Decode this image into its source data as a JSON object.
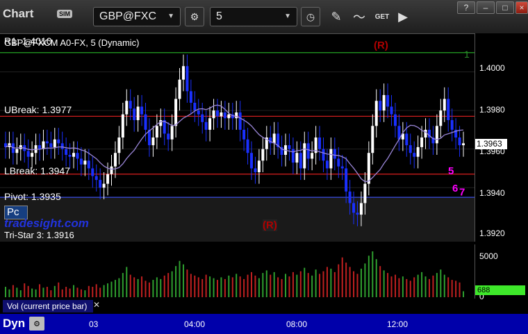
{
  "window": {
    "app_title": "Chart",
    "sim_badge": "SIM",
    "symbol": "GBP@FXC",
    "interval": "5",
    "tool_icons": [
      "settings-gear-icon",
      "clock-icon",
      "pencil-icon",
      "indicator-icon",
      "get-icon"
    ]
  },
  "chart": {
    "header": "GBP@FXCM A0-FX, 5 (Dynamic)",
    "r1_label": "R1: 1.4010",
    "right_marker": "1",
    "r_marker_top": "(R)",
    "r_marker_mid": "(R)",
    "pc_label": "Pc",
    "brand": "tradesight.com",
    "tri_star": "Tri-Star 3: 1.3916",
    "levels": [
      {
        "key": "ubreak",
        "label": "UBreak: 1.3977",
        "value": 1.3977,
        "color": "#e02020"
      },
      {
        "key": "lbreak",
        "label": "LBreak: 1.3947",
        "value": 1.3947,
        "color": "#e02020"
      },
      {
        "key": "pivot",
        "label": "Pivot: 1.3935",
        "value": 1.3935,
        "color": "#3a4de8"
      }
    ],
    "r1_value": 1.401,
    "price_ticks": [
      "1.4000",
      "1.3980",
      "1.3960",
      "1.3940",
      "1.3920"
    ],
    "last_price": "1.3963",
    "volume_ticks": [
      "5000",
      "0"
    ],
    "last_volume": "688",
    "volume_label": "Vol (current price bar)",
    "time_labels": [
      "03",
      "04:00",
      "08:00",
      "12:00"
    ],
    "dyn_label": "Dyn",
    "seq_marks": [
      "5",
      "6",
      "7"
    ],
    "colors": {
      "up": "#ffffff",
      "down": "#1a30ff",
      "ma": "#9a86d8",
      "vol_up": "#2fa02f",
      "vol_down": "#c02020",
      "marks": "#2aa02a",
      "magenta": "#ff00ff"
    }
  },
  "chart_data": {
    "type": "candlestick",
    "title": "GBP@FXCM A0-FX, 5 (Dynamic)",
    "ylim": [
      1.3912,
      1.402
    ],
    "yticks": [
      1.4,
      1.398,
      1.396,
      1.394,
      1.392
    ],
    "x_labels": [
      "03",
      "04:00",
      "08:00",
      "12:00"
    ],
    "levels": {
      "R1": 1.401,
      "UBreak": 1.3977,
      "LBreak": 1.3947,
      "Pivot": 1.3935,
      "Tri-Star 3": 1.3916
    },
    "close": [
      1.3961,
      1.3963,
      1.3958,
      1.396,
      1.3962,
      1.3959,
      1.3956,
      1.3958,
      1.3962,
      1.396,
      1.3964,
      1.3963,
      1.3961,
      1.3965,
      1.3963,
      1.396,
      1.3957,
      1.3956,
      1.3958,
      1.3955,
      1.3952,
      1.3954,
      1.395,
      1.3946,
      1.3944,
      1.394,
      1.3942,
      1.3947,
      1.3951,
      1.3958,
      1.3966,
      1.3978,
      1.3985,
      1.3981,
      1.3975,
      1.3982,
      1.3978,
      1.397,
      1.3962,
      1.3966,
      1.3972,
      1.3975,
      1.3968,
      1.3965,
      1.3972,
      1.3986,
      1.3996,
      1.4003,
      1.399,
      1.3984,
      1.398,
      1.3978,
      1.3974,
      1.397,
      1.3976,
      1.398,
      1.3977,
      1.3979,
      1.3976,
      1.3978,
      1.3976,
      1.3979,
      1.397,
      1.3965,
      1.3958,
      1.395,
      1.3948,
      1.3954,
      1.396,
      1.3966,
      1.3963,
      1.3968,
      1.3961,
      1.3957,
      1.3962,
      1.396,
      1.3953,
      1.3958,
      1.395,
      1.3963,
      1.3955,
      1.3958,
      1.3966,
      1.396,
      1.3954,
      1.395,
      1.396,
      1.3955,
      1.3951,
      1.395,
      1.3938,
      1.3932,
      1.3927,
      1.3926,
      1.3932,
      1.3942,
      1.3958,
      1.3972,
      1.3985,
      1.398,
      1.3988,
      1.3982,
      1.3978,
      1.3972,
      1.3965,
      1.3968,
      1.3962,
      1.3958,
      1.3956,
      1.3961,
      1.3966,
      1.397,
      1.3966,
      1.3963,
      1.3972,
      1.398,
      1.3986,
      1.3975,
      1.397,
      1.3966,
      1.3962,
      1.3963
    ],
    "volume": [
      1200,
      900,
      1400,
      1100,
      800,
      1600,
      1300,
      1000,
      900,
      1500,
      1100,
      1200,
      800,
      1300,
      1700,
      900,
      1200,
      1000,
      1400,
      1100,
      900,
      800,
      1300,
      1200,
      1500,
      1100,
      1400,
      1600,
      1800,
      2000,
      2200,
      2800,
      3500,
      2600,
      2300,
      2100,
      2400,
      1900,
      1700,
      2000,
      2300,
      2100,
      2500,
      2800,
      3000,
      3600,
      4200,
      3800,
      3200,
      2700,
      2500,
      2300,
      2100,
      2600,
      2400,
      2200,
      2000,
      2300,
      2100,
      2500,
      2300,
      2700,
      2400,
      2100,
      2600,
      2900,
      2500,
      2200,
      2800,
      3100,
      2600,
      2900,
      2300,
      2100,
      2700,
      2400,
      2900,
      2600,
      3000,
      3400,
      2800,
      2500,
      3200,
      2700,
      3000,
      3500,
      3300,
      2900,
      3800,
      4600,
      4000,
      3500,
      3000,
      2700,
      3300,
      3900,
      4800,
      5300,
      4400,
      3600,
      3100,
      2800,
      2400,
      2600,
      2200,
      2400,
      2100,
      1900,
      2300,
      2600,
      2900,
      2400,
      2100,
      2500,
      2800,
      3200,
      2600,
      2300,
      2000,
      1900,
      1700,
      688
    ]
  }
}
